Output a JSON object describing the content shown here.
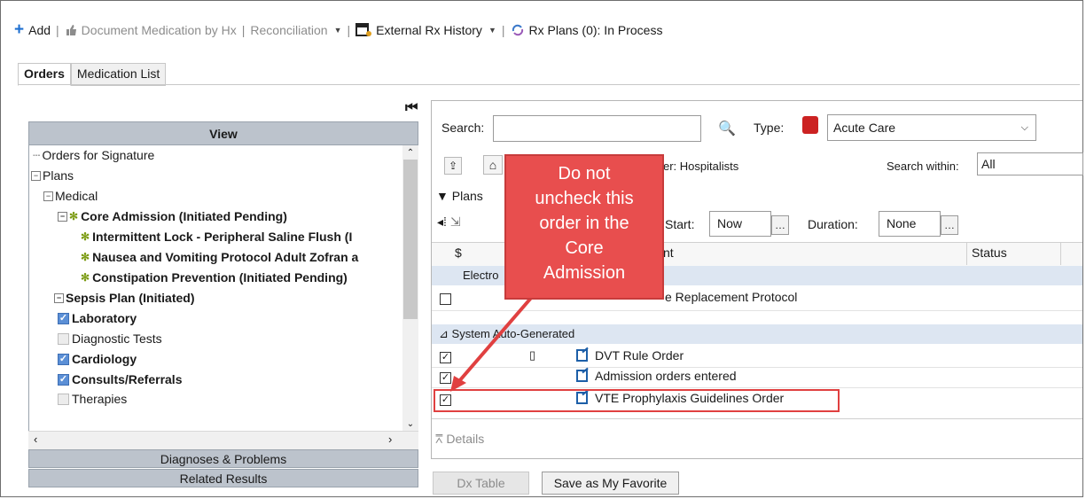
{
  "toolbar": {
    "add": "Add",
    "document_med": "Document Medication by Hx",
    "reconciliation": "Reconciliation",
    "external_rx": "External Rx History",
    "rx_plans": "Rx Plans (0): In Process"
  },
  "tabs": [
    {
      "label": "Orders",
      "active": true
    },
    {
      "label": "Medication List",
      "active": false
    }
  ],
  "left_pane": {
    "header": "View",
    "tree": [
      {
        "label": "Orders for Signature"
      },
      {
        "label": "Plans",
        "expander": "−"
      },
      {
        "label": "Medical",
        "expander": "−"
      },
      {
        "label": "Core Admission (Initiated Pending)",
        "expander": "−"
      },
      {
        "label": "Intermittent Lock - Peripheral Saline Flush (I"
      },
      {
        "label": "Nausea and Vomiting Protocol Adult Zofran a"
      },
      {
        "label": "Constipation Prevention (Initiated Pending)"
      },
      {
        "label": "Sepsis Plan (Initiated)",
        "expander": "−"
      },
      {
        "label": "Laboratory",
        "checked": true
      },
      {
        "label": "Diagnostic Tests",
        "checked": false
      },
      {
        "label": "Cardiology",
        "checked": true
      },
      {
        "label": "Consults/Referrals",
        "checked": true
      },
      {
        "label": "Therapies",
        "checked": false
      }
    ],
    "sections": [
      "Diagnoses & Problems",
      "Related Results"
    ]
  },
  "search": {
    "label": "Search:",
    "value": "",
    "type_label": "Type:",
    "type_value": "Acute Care",
    "folder_text": "er: Hospitalists",
    "within_label": "Search within:",
    "within_value": "All"
  },
  "plans": {
    "label": "Plans",
    "start_label": "Start:",
    "start_value": "Now",
    "duration_label": "Duration:",
    "duration_value": "None",
    "col_dollar": "$",
    "col_component": "nt",
    "col_status": "Status",
    "group_electrolyte": "Electro",
    "electrolyte_row": "e Replacement Protocol",
    "group_system": "System Auto-Generated",
    "orders": [
      {
        "label": "DVT Rule Order",
        "checked": true
      },
      {
        "label": "Admission orders entered",
        "checked": true
      },
      {
        "label": "VTE Prophylaxis Guidelines Order",
        "checked": true
      }
    ],
    "details_label": "Details"
  },
  "buttons": {
    "dx_table": "Dx Table",
    "save_favorite": "Save as My Favorite"
  },
  "callout": {
    "lines": [
      "Do not",
      "uncheck this",
      "order in the",
      "Core",
      "Admission"
    ]
  },
  "colors": {
    "callout": "#e84e4e",
    "highlight": "#e04040",
    "view_header": "#bcc3cc",
    "group_row": "#dde6f2"
  }
}
